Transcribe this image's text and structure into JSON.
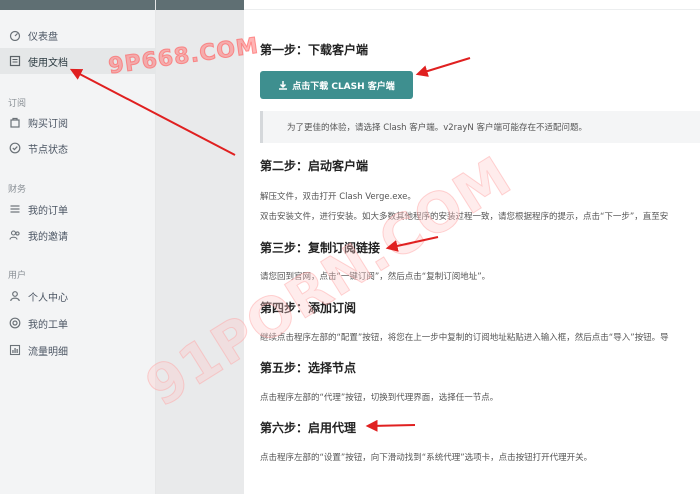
{
  "sidebar": {
    "items_top": [
      {
        "label": "仪表盘",
        "icon": "dashboard-icon"
      },
      {
        "label": "使用文档",
        "icon": "document-icon"
      }
    ],
    "sections": [
      {
        "title": "订阅",
        "items": [
          {
            "label": "购买订阅",
            "icon": "bag-icon"
          },
          {
            "label": "节点状态",
            "icon": "check-circle-icon"
          }
        ]
      },
      {
        "title": "财务",
        "items": [
          {
            "label": "我的订单",
            "icon": "list-icon"
          },
          {
            "label": "我的邀请",
            "icon": "people-icon"
          }
        ]
      },
      {
        "title": "用户",
        "items": [
          {
            "label": "个人中心",
            "icon": "user-icon"
          },
          {
            "label": "我的工单",
            "icon": "support-icon"
          },
          {
            "label": "流量明细",
            "icon": "chart-icon"
          }
        ]
      }
    ]
  },
  "doc": {
    "step1": {
      "title": "第一步：下载客户端",
      "button": "点击下载 CLASH 客户端",
      "notice": "为了更佳的体验，请选择 Clash 客户端。v2rayN 客户端可能存在不适配问题。"
    },
    "step2": {
      "title": "第二步：启动客户端",
      "line1": "解压文件，双击打开 Clash Verge.exe。",
      "line2": "双击安装文件，进行安装。如大多数其他程序的安装过程一致，请您根据程序的提示，点击“下一步”，直至安"
    },
    "step3": {
      "title": "第三步：复制订阅链接",
      "line1": "请您回到官网，点击“一键订阅”，然后点击“复制订阅地址”。"
    },
    "step4": {
      "title": "第四步：添加订阅",
      "line1": "继续点击程序左部的“配置”按钮，将您在上一步中复制的订阅地址粘贴进入输入框，然后点击“导入”按钮。导"
    },
    "step5": {
      "title": "第五步：选择节点",
      "line1": "点击程序左部的“代理”按钮，切换到代理界面，选择任一节点。"
    },
    "step6": {
      "title": "第六步：启用代理",
      "line1": "点击程序左部的“设置”按钮，向下滑动找到“系统代理”选项卡，点击按钮打开代理开关。"
    }
  },
  "watermarks": [
    "9P668.COM",
    "91PORN.COM"
  ],
  "colors": {
    "accent": "#3e8f8f",
    "arrow": "#e02020"
  }
}
